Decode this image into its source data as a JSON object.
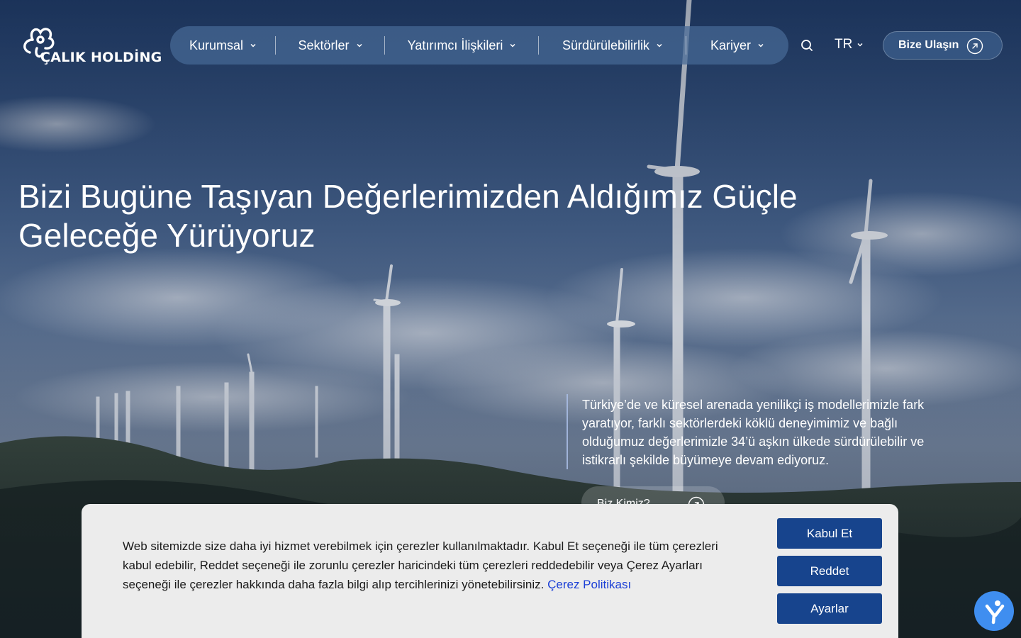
{
  "brand": {
    "name": "ÇALIK HOLDİNG"
  },
  "nav": {
    "items": [
      {
        "label": "Kurumsal"
      },
      {
        "label": "Sektörler"
      },
      {
        "label": "Yatırımcı İlişkileri"
      },
      {
        "label": "Sürdürülebilirlik"
      },
      {
        "label": "Kariyer"
      }
    ],
    "language": "TR",
    "contact_label": "Bize Ulaşın"
  },
  "hero": {
    "headline_line1": "Bizi Bugüne Taşıyan Değerlerimizden Aldığımız Güçle",
    "headline_line2": "Geleceğe Yürüyoruz",
    "intro": "Türkiye’de ve küresel arenada yenilikçi iş modellerimizle fark yaratıyor, farklı sektörlerdeki köklü deneyimimiz ve bağlı olduğumuz değerlerimizle 34’ü aşkın ülkede sürdürülebilir ve istikrarlı şekilde büyümeye devam ediyoruz.",
    "cta_label": "Biz Kimiz?"
  },
  "cookie": {
    "text": "Web sitemizde size daha iyi hizmet verebilmek için çerezler kullanılmaktadır. Kabul Et seçeneği ile tüm çerezleri kabul edebilir, Reddet seçeneği ile zorunlu çerezler haricindeki tüm çerezleri reddedebilir veya Çerez Ayarları seçeneği ile çerezler hakkında daha fazla bilgi alıp tercihlerinizi yönetebilirsiniz.",
    "policy_link": "Çerez Politikası",
    "accept_label": "Kabul Et",
    "reject_label": "Reddet",
    "settings_label": "Ayarlar"
  },
  "colors": {
    "nav_bg": "#46698f",
    "button_primary": "#17448d",
    "link": "#1b3fd6",
    "accessibility": "#3f8ef0"
  },
  "icons": {
    "search": "search-icon",
    "chevron": "chevron-down-icon",
    "arrow": "arrow-up-right-circle-icon",
    "accessibility": "accessibility-icon"
  }
}
